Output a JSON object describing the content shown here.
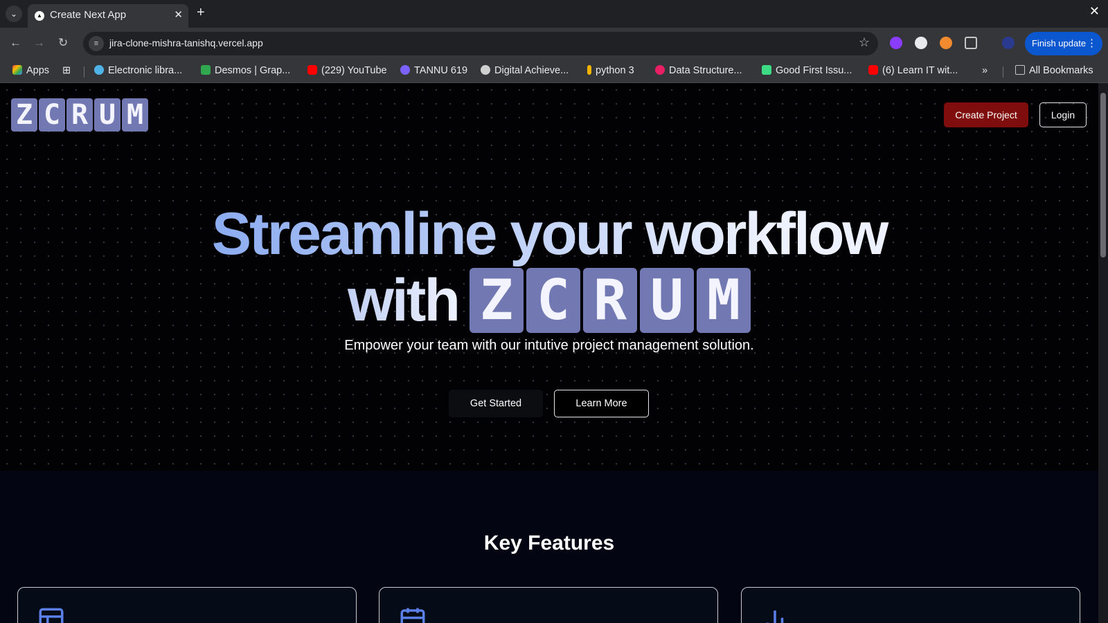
{
  "browser": {
    "tab_title": "Create Next App",
    "url": "jira-clone-mishra-tanishq.vercel.app",
    "finish_update_label": "Finish update",
    "bookmarks": [
      {
        "label": "Apps",
        "color": "#4285f4"
      },
      {
        "label": "Electronic libra...",
        "color": "#4fb3e8"
      },
      {
        "label": "Desmos | Grap...",
        "color": "#2fa84f"
      },
      {
        "label": "(229) YouTube",
        "color": "#ff0000"
      },
      {
        "label": "TANNU 619",
        "color": "#7b61ff"
      },
      {
        "label": "Digital Achieve...",
        "color": "#d0d0d0"
      },
      {
        "label": "python 3",
        "color": "#f4b400"
      },
      {
        "label": "Data Structure...",
        "color": "#e91e63"
      },
      {
        "label": "Good First Issu...",
        "color": "#3ddc84"
      },
      {
        "label": "(6) Learn IT wit...",
        "color": "#ff0000"
      }
    ],
    "all_bookmarks_label": "All Bookmarks"
  },
  "header": {
    "logo_letters": [
      "Z",
      "C",
      "R",
      "U",
      "M"
    ],
    "create_project_label": "Create Project",
    "login_label": "Login",
    "accent_color": "#7f0d0d"
  },
  "hero": {
    "title_line1": "Streamline your workflow",
    "title_with": "with",
    "logo_letters": [
      "Z",
      "C",
      "R",
      "U",
      "M"
    ],
    "subtitle": "Empower your team with our intutive project management solution.",
    "get_started_label": "Get Started",
    "learn_more_label": "Learn More"
  },
  "features": {
    "title": "Key Features",
    "cards": [
      {
        "icon": "layout-icon"
      },
      {
        "icon": "calendar-icon"
      },
      {
        "icon": "bar-chart-icon"
      }
    ]
  }
}
